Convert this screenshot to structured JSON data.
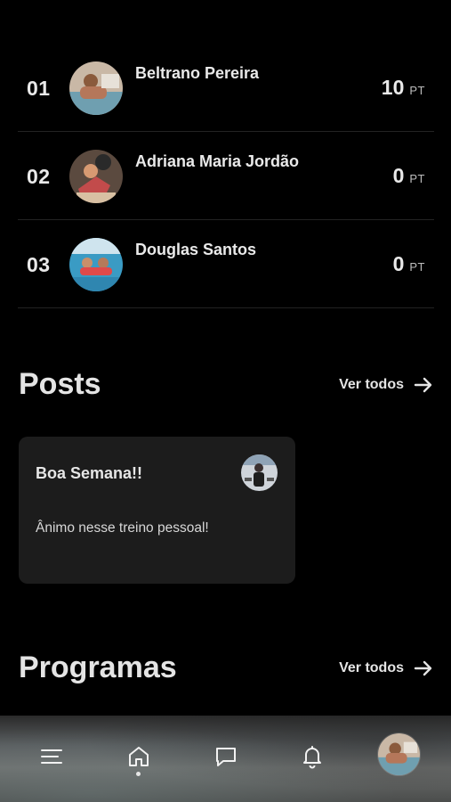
{
  "ranking": [
    {
      "position": "01",
      "name": "Beltrano Pereira",
      "score": "10",
      "unit": "PT"
    },
    {
      "position": "02",
      "name": "Adriana Maria Jordão",
      "score": "0",
      "unit": "PT"
    },
    {
      "position": "03",
      "name": "Douglas Santos",
      "score": "0",
      "unit": "PT"
    }
  ],
  "posts_section": {
    "title": "Posts",
    "see_all": "Ver todos",
    "card": {
      "title": "Boa Semana!!",
      "body": "Ânimo nesse treino pessoal!"
    }
  },
  "programs_section": {
    "title": "Programas",
    "see_all": "Ver todos"
  },
  "bottom_nav": {
    "items": [
      "menu-icon",
      "home-icon",
      "chat-icon",
      "bell-icon",
      "profile-avatar"
    ],
    "active": "home-icon"
  },
  "colors": {
    "background": "#000000",
    "card": "#1c1c1c",
    "text": "#e9e9e9"
  }
}
